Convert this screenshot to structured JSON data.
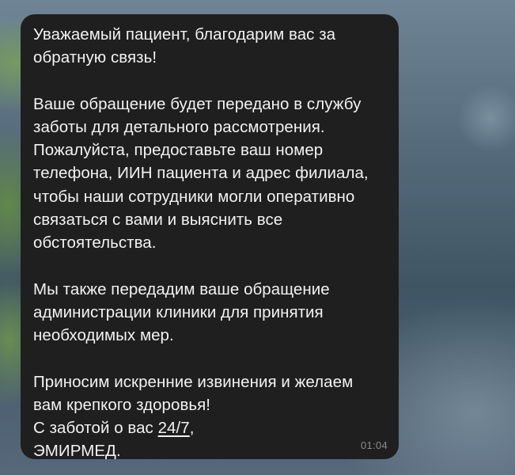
{
  "message": {
    "paragraphs": [
      {
        "lines": [
          "Уважаемый пациент, благодарим вас за",
          "обратную связь!"
        ]
      },
      {
        "lines": [
          "Ваше обращение будет передано в службу",
          "заботы для детального рассмотрения.",
          "Пожалуйста, предоставьте ваш номер",
          "телефона, ИИН пациента и адрес филиала,",
          "чтобы наши сотрудники могли оперативно",
          "связаться с вами и выяснить все",
          "обстоятельства."
        ]
      },
      {
        "lines": [
          "Мы также передадим ваше обращение",
          "администрации клиники для принятия",
          "необходимых мер."
        ]
      },
      {
        "lines": [
          "Приносим искренние извинения и желаем",
          "вам крепкого здоровья!"
        ]
      }
    ],
    "signature_prefix": "С заботой о вас ",
    "signature_link": "24/7",
    "signature_suffix": ",",
    "signature_name": "ЭМИРМЕД.",
    "time": "01:04"
  }
}
